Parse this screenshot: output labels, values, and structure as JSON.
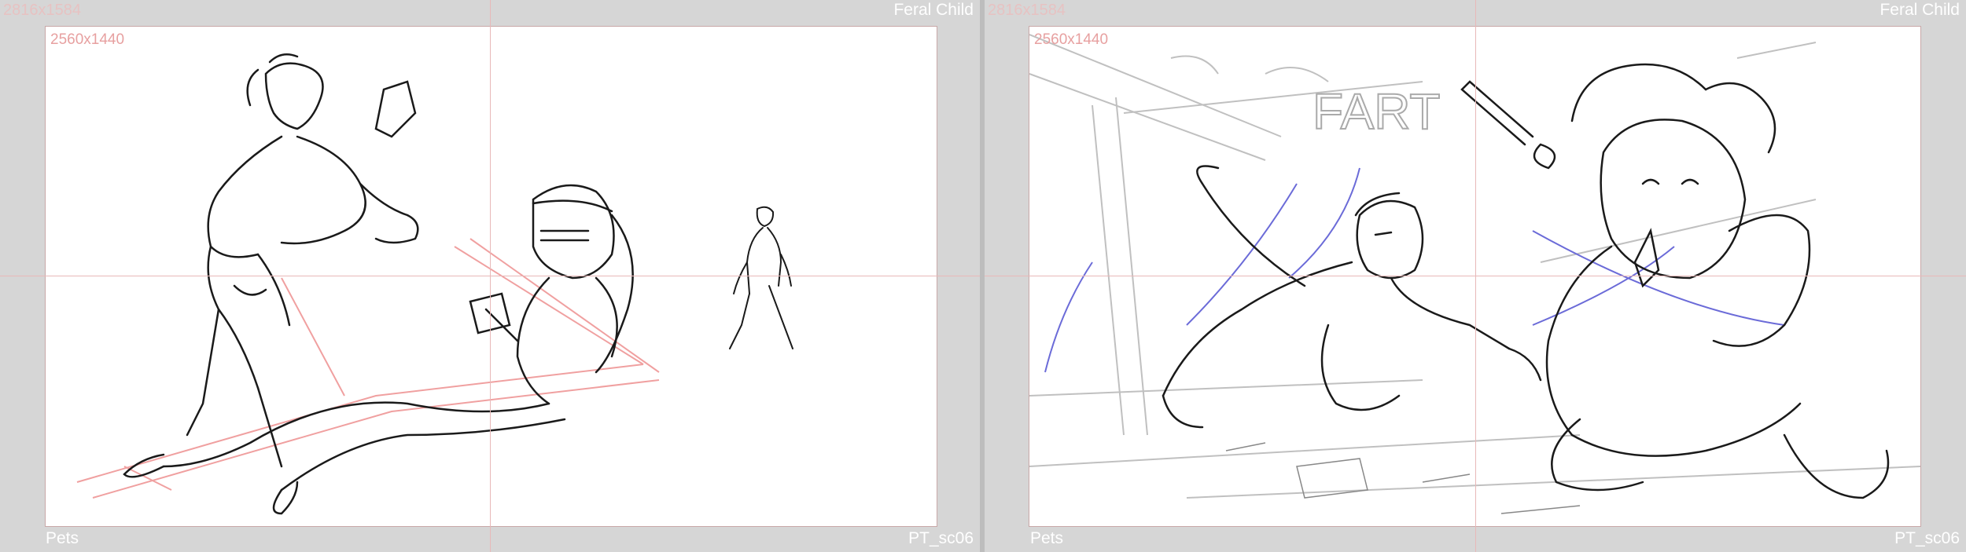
{
  "panels": [
    {
      "outer_resolution": "2816x1584",
      "safe_resolution": "2560x1440",
      "project_title": "Feral Child",
      "project_name": "Pets",
      "scene_code": "PT_sc06"
    },
    {
      "outer_resolution": "2816x1584",
      "safe_resolution": "2560x1440",
      "project_title": "Feral Child",
      "project_name": "Pets",
      "scene_code": "PT_sc06"
    }
  ],
  "drawings": {
    "left_scene": "beach-sunscreen-sketch",
    "right_scene": "baby-crayon-sketch",
    "scribble_text": "FART"
  },
  "colors": {
    "background": "#cfcfcf",
    "canvas": "#ffffff",
    "guide": "#e8b8b8",
    "ink": "#1a1a1a",
    "pink_line": "#f0a0a0",
    "blue_line": "#6b6bd8",
    "light_line": "#c0c0c0"
  }
}
